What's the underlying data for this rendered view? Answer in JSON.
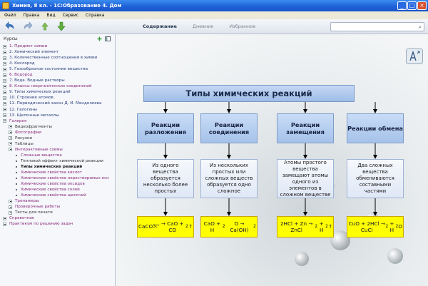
{
  "window": {
    "title": "Химия, 8 кл. - 1С:Образование 4. Дом",
    "buttons": {
      "minimize": "_",
      "maximize": "□",
      "close": "×"
    }
  },
  "menu": [
    "Файл",
    "Правка",
    "Вид",
    "Сервис",
    "Справка"
  ],
  "toolbar": {
    "tabs": [
      "Содержание",
      "Дневник",
      "Избранное"
    ],
    "active_tab": "Содержание",
    "search_placeholder": ""
  },
  "sidebar": {
    "header": "Курсы",
    "items": [
      {
        "label": "1. Предмет химии",
        "color": "purple",
        "kind": "exp",
        "level": 0
      },
      {
        "label": "2. Химический элемент",
        "color": "blue",
        "kind": "exp",
        "level": 0
      },
      {
        "label": "3. Количественные соотношения в химии",
        "color": "blue",
        "kind": "exp",
        "level": 0
      },
      {
        "label": "4. Кислород",
        "color": "blue",
        "kind": "exp",
        "level": 0
      },
      {
        "label": "5. Газообразное состояние вещества",
        "color": "blue",
        "kind": "exp",
        "level": 0
      },
      {
        "label": "6. Водород",
        "color": "purple",
        "kind": "exp",
        "level": 0
      },
      {
        "label": "7. Вода. Водные растворы",
        "color": "blue",
        "kind": "exp",
        "level": 0
      },
      {
        "label": "8. Классы неорганических соединений",
        "color": "purple",
        "kind": "exp",
        "level": 0
      },
      {
        "label": "9. Типы химических реакций",
        "color": "blue",
        "kind": "exp",
        "level": 0
      },
      {
        "label": "10. Строение атомов",
        "color": "blue",
        "kind": "exp",
        "level": 0
      },
      {
        "label": "11. Периодический закон Д. И. Менделеева",
        "color": "blue",
        "kind": "exp",
        "level": 0
      },
      {
        "label": "12. Галогены",
        "color": "blue",
        "kind": "exp",
        "level": 0
      },
      {
        "label": "13. Щелочные металлы",
        "color": "blue",
        "kind": "exp",
        "level": 0
      },
      {
        "label": "Галерея",
        "color": "purple",
        "kind": "exp",
        "level": 0
      },
      {
        "label": "Видеофрагменты",
        "color": "dark",
        "kind": "exp",
        "level": 1
      },
      {
        "label": "Фотографии",
        "color": "purple",
        "kind": "exp",
        "level": 1
      },
      {
        "label": "Рисунки",
        "color": "dark",
        "kind": "exp",
        "level": 1
      },
      {
        "label": "Таблицы",
        "color": "dark",
        "kind": "exp",
        "level": 1
      },
      {
        "label": "Интерактивные схемы",
        "color": "purple",
        "kind": "exp",
        "level": 1
      },
      {
        "label": "Сложные вещества",
        "color": "purple",
        "kind": "bullet",
        "level": 2
      },
      {
        "label": "Тепловой эффект химической реакции",
        "color": "dark",
        "kind": "bullet",
        "level": 2
      },
      {
        "label": "Типы химических реакций",
        "color": "bold",
        "kind": "bullet",
        "level": 2
      },
      {
        "label": "Химические свойства кислот",
        "color": "purple",
        "kind": "bullet",
        "level": 2
      },
      {
        "label": "Химические свойства нерастворимых осн",
        "color": "purple",
        "kind": "bullet",
        "level": 2
      },
      {
        "label": "Химические свойства оксидов",
        "color": "purple",
        "kind": "bullet",
        "level": 2
      },
      {
        "label": "Химические свойства солей",
        "color": "purple",
        "kind": "bullet",
        "level": 2
      },
      {
        "label": "Химические свойства щелочей",
        "color": "purple",
        "kind": "bullet",
        "level": 2
      },
      {
        "label": "Тренажеры",
        "color": "purple",
        "kind": "exp",
        "level": 1
      },
      {
        "label": "Проверочные работы",
        "color": "purple",
        "kind": "exp",
        "level": 1
      },
      {
        "label": "Тесты для печати",
        "color": "dark",
        "kind": "exp",
        "level": 1
      },
      {
        "label": "Справочник",
        "color": "purple",
        "kind": "exp",
        "level": 0
      },
      {
        "label": "Практикум по решению задач",
        "color": "purple",
        "kind": "exp",
        "level": 0
      }
    ]
  },
  "diagram": {
    "title": "Типы химических реакций",
    "columns": [
      {
        "heading": "Реакции разложения",
        "description": "Из одного вещества образуется несколько более простых",
        "equation_html": "CaCO<sub>3</sub> <span style='font-size:6px'>t°</span>→ CaO + CO<sub>2</sub>↑"
      },
      {
        "heading": "Реакции соединения",
        "description": "Из нескольких простых или сложных веществ образуется одно сложное",
        "equation_html": "CaO + H<sub>2</sub>O → Ca(OH)<sub>2</sub>"
      },
      {
        "heading": "Реакции замещения",
        "description": "Атомы простого вещества замещают атомы одного из элементов в сложном веществе",
        "equation_html": "2HCl + Zn → ZnCl<sub>2</sub> + H<sub>2</sub>↑"
      },
      {
        "heading": "Реакции обмена",
        "description": "Два сложных вещества обмениваются составными частями",
        "equation_html": "CuO + 2HCl → CuCl<sub>2</sub> + H<sub>2</sub>O"
      }
    ]
  },
  "colors": {
    "title_bar": "#1d5fd6",
    "menu_bar": "#ece9d8",
    "category_box": "#a5c2ea",
    "equation_box": "#ffff00",
    "arrow": "#000000"
  },
  "icons": {
    "back": "back-arrow-icon",
    "forward": "forward-arrow-icon",
    "up": "up-arrow-icon",
    "download": "green-down-arrow-icon",
    "search": "search-icon",
    "zoom": "zoom-icon"
  }
}
